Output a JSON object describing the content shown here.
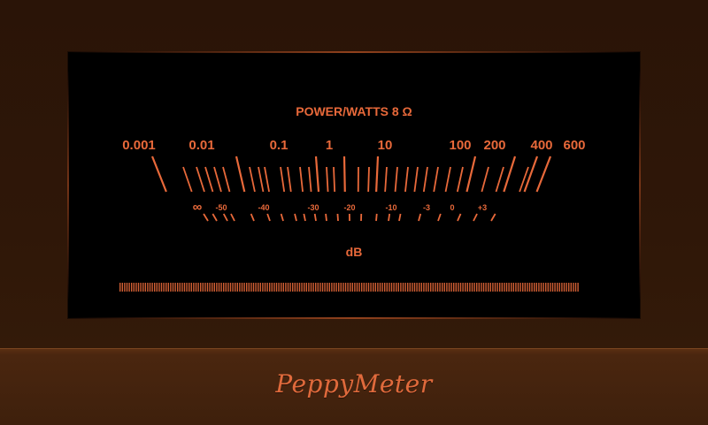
{
  "app": {
    "brand": "PeppyMeter"
  },
  "colors": {
    "scale": "#e8693a",
    "meter_background": "#000000",
    "frame": "#2f1708"
  },
  "meter": {
    "title": "POWER/WATTS 8 Ω",
    "power_labels": [
      "0.001",
      "0.01",
      "0.1",
      "1",
      "10",
      "100",
      "200",
      "400",
      "600"
    ],
    "db_labels": [
      "∞",
      "-50",
      "-40",
      "-30",
      "-20",
      "-10",
      "-3",
      "0",
      "+3"
    ],
    "unit": "dB",
    "level": 0.0
  }
}
